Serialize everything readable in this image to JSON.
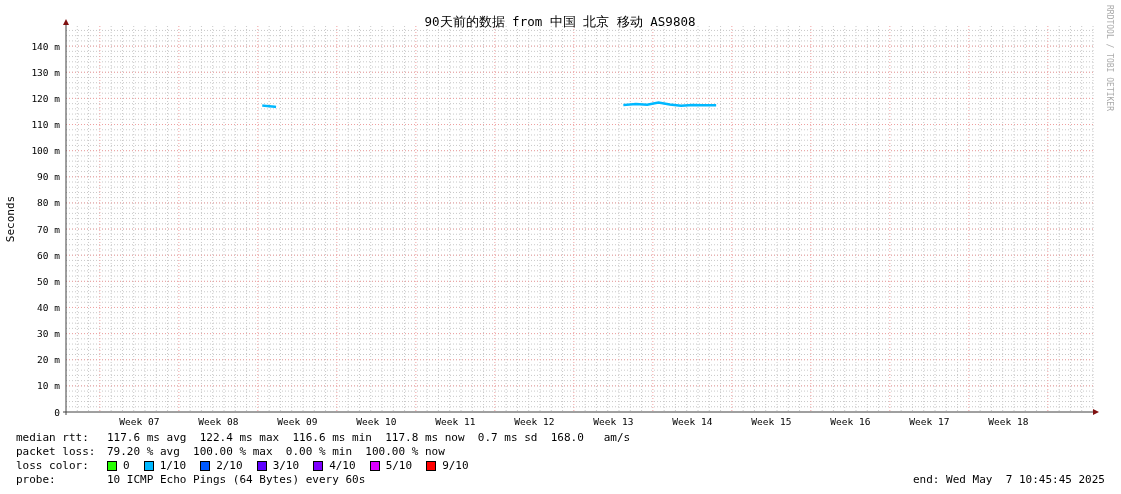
{
  "graph": {
    "credit": "RRDTOOL / TOBI OETIKER",
    "chart_data": {
      "type": "line",
      "title": "90天前的数据 from 中国 北京 移动 AS9808",
      "ylabel": "Seconds",
      "grid": true,
      "ylim": [
        0,
        147.7
      ],
      "yticks": [
        {
          "value": 0,
          "label": "0"
        },
        {
          "value": 10,
          "label": "10 m"
        },
        {
          "value": 20,
          "label": "20 m"
        },
        {
          "value": 30,
          "label": "30 m"
        },
        {
          "value": 40,
          "label": "40 m"
        },
        {
          "value": 50,
          "label": "50 m"
        },
        {
          "value": 60,
          "label": "60 m"
        },
        {
          "value": 70,
          "label": "70 m"
        },
        {
          "value": 80,
          "label": "80 m"
        },
        {
          "value": 90,
          "label": "90 m"
        },
        {
          "value": 100,
          "label": "100 m"
        },
        {
          "value": 110,
          "label": "110 m"
        },
        {
          "value": 120,
          "label": "120 m"
        },
        {
          "value": 130,
          "label": "130 m"
        },
        {
          "value": 140,
          "label": "140 m"
        }
      ],
      "categories": [
        null,
        null,
        null,
        null,
        null,
        null,
        "Week 07",
        null,
        null,
        null,
        null,
        null,
        null,
        "Week 08",
        null,
        null,
        null,
        null,
        null,
        null,
        "Week 09",
        null,
        null,
        null,
        null,
        null,
        null,
        "Week 10",
        null,
        null,
        null,
        null,
        null,
        null,
        "Week 11",
        null,
        null,
        null,
        null,
        null,
        null,
        "Week 12",
        null,
        null,
        null,
        null,
        null,
        null,
        "Week 13",
        null,
        null,
        null,
        null,
        null,
        null,
        "Week 14",
        null,
        null,
        null,
        null,
        null,
        null,
        "Week 15",
        null,
        null,
        null,
        null,
        null,
        null,
        "Week 16",
        null,
        null,
        null,
        null,
        null,
        null,
        "Week 17",
        null,
        null,
        null,
        null,
        null,
        null,
        "Week 18",
        null,
        null,
        null,
        null,
        null,
        null,
        null
      ],
      "series": [
        {
          "name": "median rtt:",
          "color": "#00b8ff",
          "values": [
            null,
            null,
            null,
            null,
            null,
            null,
            null,
            null,
            null,
            null,
            null,
            null,
            null,
            null,
            null,
            null,
            null,
            117.2,
            116.8,
            null,
            null,
            null,
            null,
            null,
            null,
            null,
            null,
            null,
            null,
            null,
            null,
            null,
            null,
            null,
            null,
            null,
            null,
            null,
            null,
            null,
            null,
            null,
            null,
            null,
            null,
            null,
            null,
            null,
            null,
            117.5,
            117.8,
            117.6,
            118.4,
            117.7,
            117.2,
            117.5,
            117.4,
            117.4,
            null,
            null,
            null,
            null,
            null,
            null,
            null,
            null,
            null,
            null,
            null,
            null,
            null,
            null,
            null,
            null,
            null,
            null,
            null,
            null,
            null,
            null,
            null,
            null,
            null,
            null,
            null,
            null,
            null,
            null,
            null,
            null,
            null
          ]
        }
      ]
    }
  },
  "legend": {
    "rows": [
      {
        "text": "117.6 ms avg  122.4 ms max  116.6 ms min  117.8 ms now  0.7 ms sd  168.0   am/s"
      },
      {
        "label": "packet loss:",
        "text": "79.20 % avg  100.00 % max  0.00 % min  100.00 % now"
      }
    ],
    "loss_color": {
      "label": "loss color:",
      "items": [
        {
          "label": "0",
          "color": "#26ff00"
        },
        {
          "label": "1/10",
          "color": "#00b8ff"
        },
        {
          "label": "2/10",
          "color": "#0059ff"
        },
        {
          "label": "3/10",
          "color": "#5e00ff"
        },
        {
          "label": "4/10",
          "color": "#7e00ff"
        },
        {
          "label": "5/10",
          "color": "#dd00ff"
        },
        {
          "label": "9/10",
          "color": "#ff0000"
        }
      ]
    },
    "probe": {
      "label": "probe:",
      "text": "10 ICMP Echo Pings (64 Bytes) every 60s"
    },
    "end": "end: Wed May  7 10:45:45 2025"
  }
}
